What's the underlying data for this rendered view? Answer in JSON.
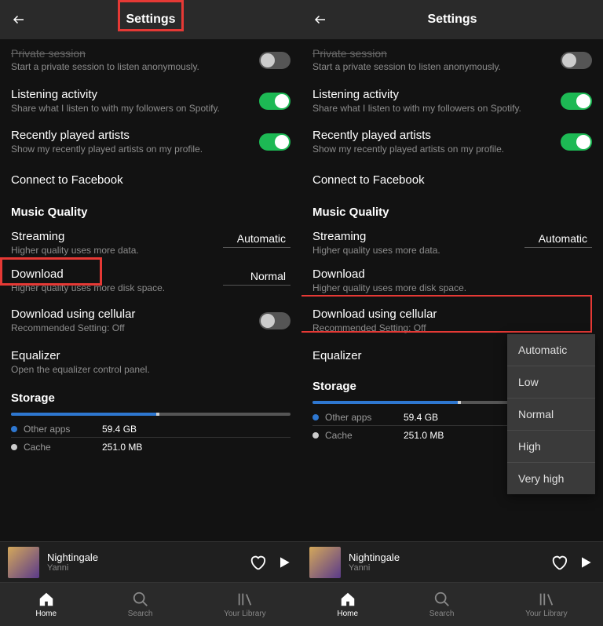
{
  "left": {
    "title": "Settings",
    "rows": {
      "private": {
        "main": "Private session",
        "sub": "Start a private session to listen anonymously."
      },
      "listening": {
        "main": "Listening activity",
        "sub": "Share what I listen to with my followers on Spotify."
      },
      "recently": {
        "main": "Recently played artists",
        "sub": "Show my recently played artists on my profile."
      },
      "facebook": {
        "main": "Connect to Facebook"
      }
    },
    "mq_title": "Music Quality",
    "streaming": {
      "main": "Streaming",
      "sub": "Higher quality uses more data.",
      "value": "Automatic"
    },
    "download": {
      "main": "Download",
      "sub": "Higher quality uses more disk space.",
      "value": "Normal"
    },
    "cellular": {
      "main": "Download using cellular",
      "sub": "Recommended Setting: Off"
    },
    "equalizer": {
      "main": "Equalizer",
      "sub": "Open the equalizer control panel."
    },
    "storage_title": "Storage",
    "storage": {
      "other": {
        "label": "Other apps",
        "value": "59.4 GB"
      },
      "cache": {
        "label": "Cache",
        "value": "251.0 MB"
      }
    },
    "nowplay": {
      "title": "Nightingale",
      "artist": "Yanni"
    },
    "nav": {
      "home": "Home",
      "search": "Search",
      "library": "Your Library"
    }
  },
  "right": {
    "title": "Settings",
    "rows": {
      "private": {
        "main": "Private session",
        "sub": "Start a private session to listen anonymously."
      },
      "listening": {
        "main": "Listening activity",
        "sub": "Share what I listen to with my followers on Spotify."
      },
      "recently": {
        "main": "Recently played artists",
        "sub": "Show my recently played artists on my profile."
      },
      "facebook": {
        "main": "Connect to Facebook"
      }
    },
    "mq_title": "Music Quality",
    "streaming": {
      "main": "Streaming",
      "sub": "Higher quality uses more data.",
      "value": "Automatic"
    },
    "download": {
      "main": "Download",
      "sub": "Higher quality uses more disk space."
    },
    "cellular": {
      "main": "Download using cellular",
      "sub": "Recommended Setting: Off"
    },
    "equalizer": {
      "main": "Equalizer"
    },
    "storage_title": "Storage",
    "storage": {
      "other": {
        "label": "Other apps",
        "value": "59.4 GB"
      },
      "cache": {
        "label": "Cache",
        "value": "251.0 MB"
      }
    },
    "dropdown": [
      "Automatic",
      "Low",
      "Normal",
      "High",
      "Very high"
    ],
    "nowplay": {
      "title": "Nightingale",
      "artist": "Yanni"
    },
    "nav": {
      "home": "Home",
      "search": "Search",
      "library": "Your Library"
    }
  }
}
